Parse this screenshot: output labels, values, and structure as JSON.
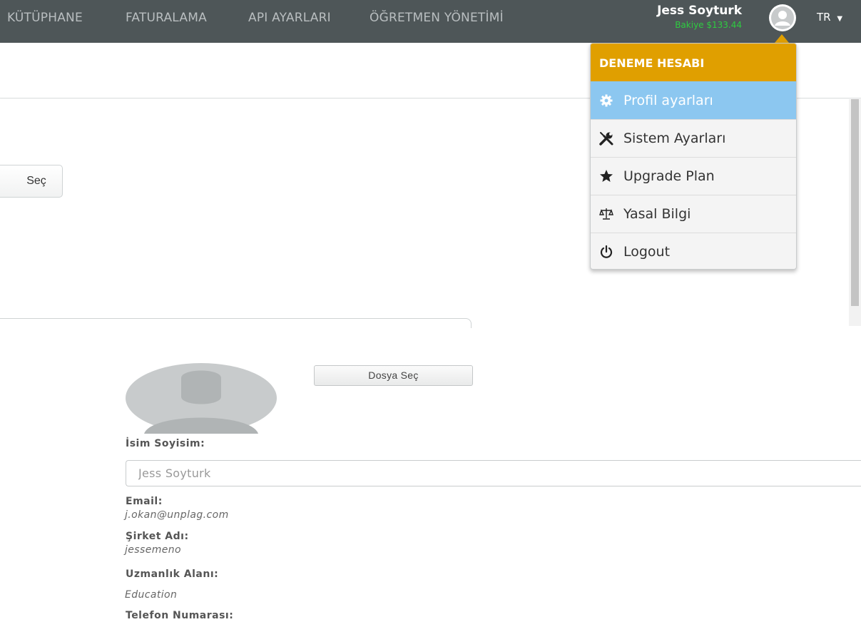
{
  "nav": {
    "links": [
      "KÜTÜPHANE",
      "FATURALAMA",
      "API AYARLARI",
      "ÖĞRETMEN YÖNETİMİ"
    ],
    "user_name": "Jess Soyturk",
    "balance": "Bakiye $133.44",
    "language": "TR"
  },
  "toolbar": {
    "select_button": "Seç"
  },
  "dropdown": {
    "header": "DENEME HESABI",
    "items": [
      {
        "label": "Profil ayarları",
        "icon": "gear-icon"
      },
      {
        "label": "Sistem Ayarları",
        "icon": "wrench-screwdriver-icon"
      },
      {
        "label": "Upgrade Plan",
        "icon": "star-icon"
      },
      {
        "label": "Yasal Bilgi",
        "icon": "scales-icon"
      },
      {
        "label": "Logout",
        "icon": "power-icon"
      }
    ]
  },
  "profile": {
    "file_button": "Dosya Seç",
    "name_label": "İsim Soyisim:",
    "name_value": "Jess Soyturk",
    "email_label": "Email:",
    "email_value": "j.okan@unplag.com",
    "company_label": "Şirket Adı:",
    "company_value": "jessemeno",
    "expertise_label": "Uzmanlık Alanı:",
    "expertise_value": "Education",
    "phone_label": "Telefon Numarası:"
  },
  "colors": {
    "navbar": "#4e5658",
    "dropdown_header": "#e09f00",
    "active_item": "#8cc7f0",
    "balance": "#2ecc40"
  }
}
